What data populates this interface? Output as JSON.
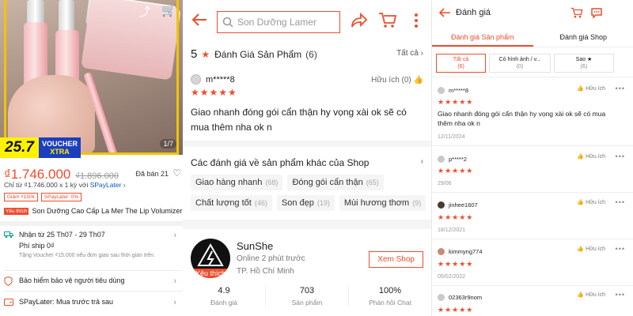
{
  "panel1": {
    "image_counter": "1/7",
    "voucher": {
      "day": "25.7",
      "top": "VOUCHER",
      "bottom": "XTRA"
    },
    "price": "₫1.746.000",
    "old_price": "₫1.896.000",
    "sold": "Đã bán 21",
    "sub_price_prefix": "Chỉ từ ₫1.746.000 x 1 kỳ với",
    "sub_price_brand": "SPayLater",
    "tags": [
      "Giảm ₫150k",
      "SPayLater: 0%"
    ],
    "fav_label": "Yêu thích",
    "product_title": "Son Dưỡng Cao Cấp La Mer The Lip Volumizer",
    "shipping": {
      "date": "Nhận từ 25 Th07 - 29 Th07",
      "fee": "Phí ship 0₫",
      "note": "Tặng Voucher ₫15.000 nếu đơn giao sau thời gian trên."
    },
    "protection": "Bảo hiểm bảo vệ người tiêu dùng",
    "spaylater": "SPayLater: Mua trước trả sau"
  },
  "panel2": {
    "search_placeholder": "Son Dưỡng Lamer",
    "rating_value": "5",
    "reviews_title": "Đánh Giá Sản Phẩm",
    "reviews_count": "(6)",
    "see_all": "Tất cả",
    "review": {
      "user": "m*****8",
      "helpful": "Hữu ích (0)",
      "stars": "★★★★★",
      "text": "Giao nhanh đóng gói cẩn thận hy vọng xài ok sẽ có mua thêm nha ok n"
    },
    "shop_reviews_title": "Các đánh giá về sản phẩm khác của Shop",
    "chips": [
      {
        "label": "Giao hàng nhanh",
        "count": "(68)"
      },
      {
        "label": "Đóng gói cẩn thận",
        "count": "(65)"
      },
      {
        "label": "Chất lượng tốt",
        "count": "(46)"
      },
      {
        "label": "Son đẹp",
        "count": "(19)"
      },
      {
        "label": "Mùi hương thơm",
        "count": "(9)"
      }
    ],
    "shop": {
      "name": "SunShe",
      "badge": "Yêu thích",
      "online": "Online 2 phút trước",
      "location": "TP. Hồ Chí Minh",
      "view_button": "Xem Shop",
      "stats": [
        {
          "value": "4.9",
          "label": "Đánh giá"
        },
        {
          "value": "703",
          "label": "Sản phẩm"
        },
        {
          "value": "100%",
          "label": "Phản hồi Chat"
        }
      ]
    }
  },
  "panel3": {
    "title": "Đánh giá",
    "tabs": [
      "Đánh giá Sản phẩm",
      "Đánh giá Shop"
    ],
    "filters": [
      {
        "label": "Tất cả",
        "count": "(6)"
      },
      {
        "label": "Có hình ảnh / v...",
        "count": "(0)"
      },
      {
        "label": "Sao ★",
        "count": "(6)"
      }
    ],
    "reviews": [
      {
        "user": "m*****8",
        "helpful": "Hữu ích",
        "stars": "★★★★★",
        "text": "Giao nhanh đóng gói cẩn thận hy vọng xài ok sẽ có mua thêm nha ok n",
        "date": "12/11/2024"
      },
      {
        "user": "p*****2",
        "helpful": "Hữu ích",
        "stars": "★★★★★",
        "text": "",
        "date": "29/06"
      },
      {
        "user": "jinhee1607",
        "helpful": "Hữu ích",
        "stars": "★★★★★",
        "text": "",
        "date": "18/12/2021"
      },
      {
        "user": "kimmyng774",
        "helpful": "Hữu ích",
        "stars": "★★★★★",
        "text": "",
        "date": "05/02/2022"
      },
      {
        "user": "02363r9nom",
        "helpful": "Hữu ích",
        "stars": "★★★★★",
        "text": "",
        "date": ""
      }
    ]
  },
  "colors": {
    "accent": "#ee4d2d",
    "voucher_yellow": "#fff200",
    "voucher_blue": "#1c3fbf"
  }
}
